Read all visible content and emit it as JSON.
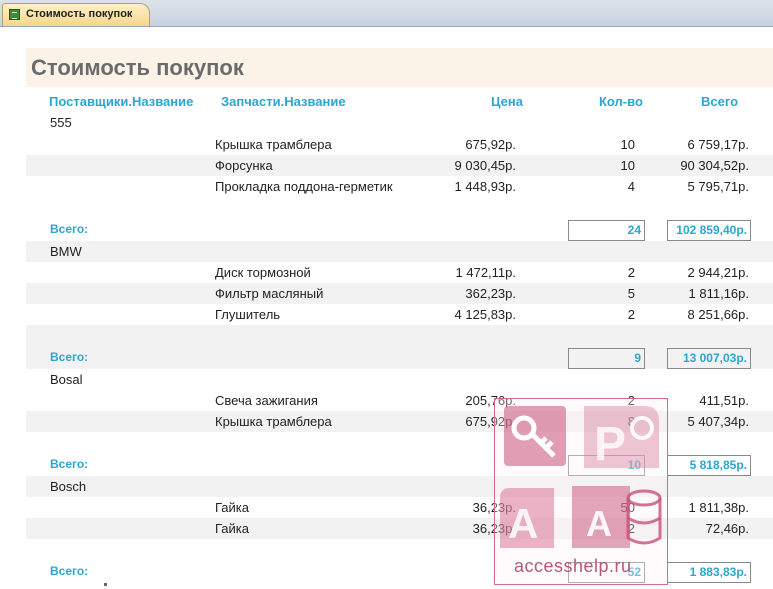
{
  "tab": {
    "label": "Стоимость покупок",
    "icon": "report-icon"
  },
  "report": {
    "title": "Стоимость покупок",
    "columns": {
      "supplier": "Поставщики.Название",
      "part": "Запчасти.Название",
      "price": "Цена",
      "qty": "Кол-во",
      "total": "Всего"
    },
    "total_label": "Всего:",
    "groups": [
      {
        "supplier": "555",
        "rows": [
          {
            "part": "Крышка трамблера",
            "price": "675,92р.",
            "qty": "10",
            "total": "6 759,17р."
          },
          {
            "part": "Форсунка",
            "price": "9 030,45р.",
            "qty": "10",
            "total": "90 304,52р."
          },
          {
            "part": "Прокладка поддона-герметик",
            "price": "1 448,93р.",
            "qty": "4",
            "total": "5 795,71р."
          }
        ],
        "sum_qty": "24",
        "sum_total": "102 859,40р."
      },
      {
        "supplier": "BMW",
        "rows": [
          {
            "part": "Диск тормозной",
            "price": "1 472,11р.",
            "qty": "2",
            "total": "2 944,21р."
          },
          {
            "part": "Фильтр масляный",
            "price": "362,23р.",
            "qty": "5",
            "total": "1 811,16р."
          },
          {
            "part": "Глушитель",
            "price": "4 125,83р.",
            "qty": "2",
            "total": "8 251,66р."
          }
        ],
        "sum_qty": "9",
        "sum_total": "13 007,03р."
      },
      {
        "supplier": "Bosal",
        "rows": [
          {
            "part": "Свеча зажигания",
            "price": "205,76р.",
            "qty": "2",
            "total": "411,51р."
          },
          {
            "part": "Крышка трамблера",
            "price": "675,92р.",
            "qty": "8",
            "total": "5 407,34р."
          }
        ],
        "sum_qty": "10",
        "sum_total": "5 818,85р."
      },
      {
        "supplier": "Bosch",
        "rows": [
          {
            "part": "Гайка",
            "price": "36,23р.",
            "qty": "50",
            "total": "1 811,38р."
          },
          {
            "part": "Гайка",
            "price": "36,23р.",
            "qty": "2",
            "total": "72,46р."
          }
        ],
        "sum_qty": "52",
        "sum_total": "1 883,83р."
      }
    ]
  },
  "watermark": {
    "text": "accesshelp.ru",
    "icon": "access-logo-icon"
  }
}
